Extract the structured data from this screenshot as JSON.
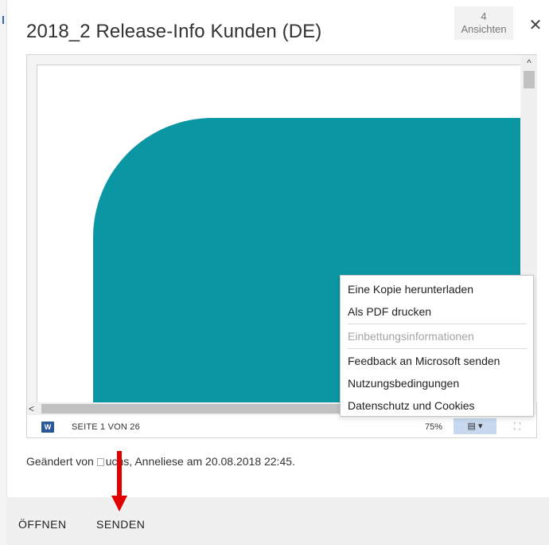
{
  "dialog": {
    "title": "2018_2 Release-Info Kunden (DE)",
    "views_count": "4",
    "views_label": "Ansichten",
    "close_symbol": "✕"
  },
  "viewer": {
    "app_icon": "word-icon",
    "app_icon_letter": "W",
    "page_info": "SEITE 1 VON 26",
    "zoom": "75%",
    "view_button_symbol": "▤ ▾",
    "fullscreen_symbol": "⛶",
    "scroll_up_symbol": "^",
    "scroll_left_symbol": "<",
    "accent_color": "#0a97a3"
  },
  "menu": {
    "items": [
      "Eine Kopie herunterladen",
      "Als PDF drucken",
      "Einbettungsinformationen",
      "Feedback an Microsoft senden",
      "Nutzungsbedingungen",
      "Datenschutz und Cookies"
    ]
  },
  "changed": {
    "prefix": "Geändert von",
    "rest": "uchs, Anneliese am 20.08.2018 22:45."
  },
  "footer": {
    "open_label": "ÖFFNEN",
    "send_label": "SENDEN"
  },
  "annotation": {
    "arrow_color": "#e00000"
  }
}
